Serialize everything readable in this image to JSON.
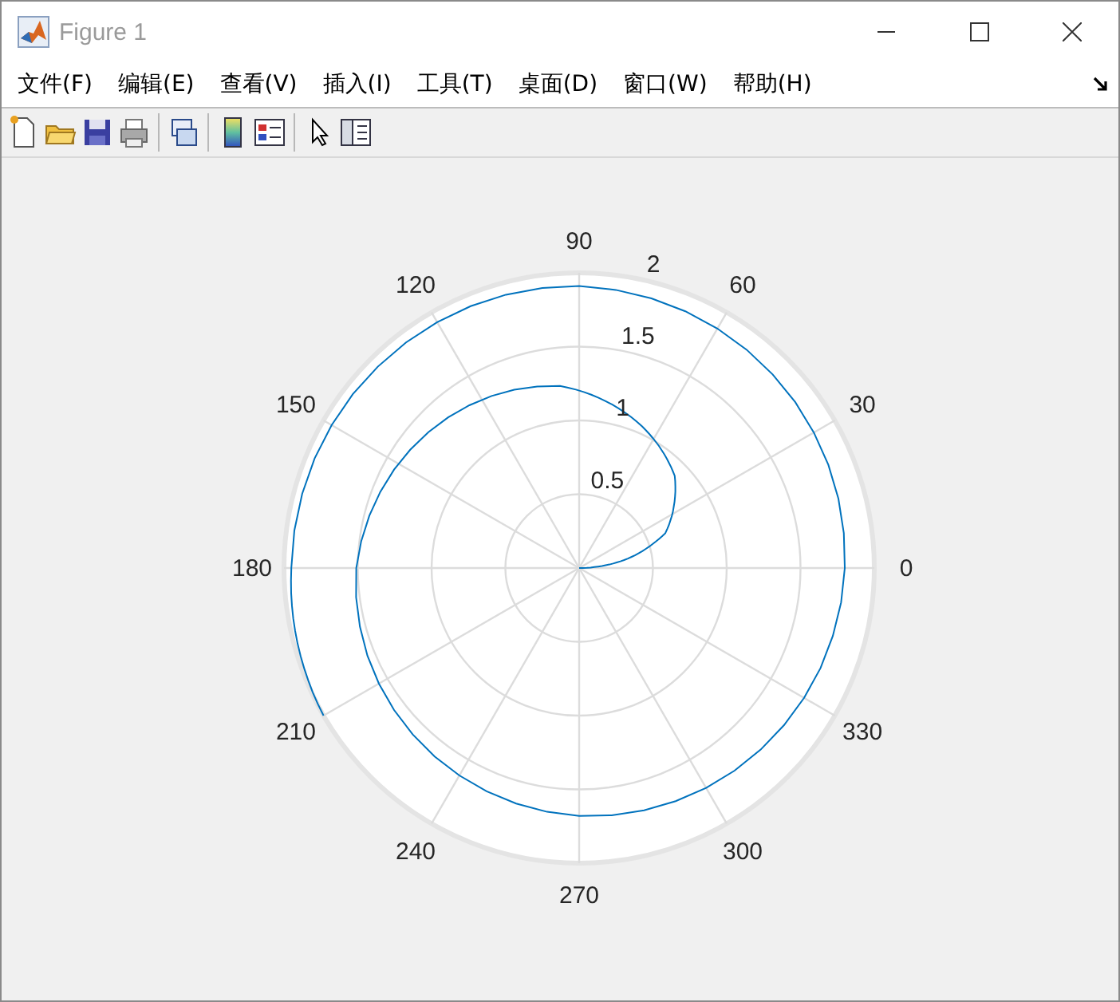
{
  "window": {
    "title": "Figure 1"
  },
  "menu": [
    "文件(F)",
    "编辑(E)",
    "查看(V)",
    "插入(I)",
    "工具(T)",
    "桌面(D)",
    "窗口(W)",
    "帮助(H)"
  ],
  "polar_plot": {
    "angle_labels": [
      "0",
      "30",
      "60",
      "90",
      "120",
      "150",
      "180",
      "210",
      "240",
      "270",
      "300",
      "330"
    ],
    "radius_labels": [
      "2",
      "1.5",
      "1",
      "0.5"
    ]
  }
}
